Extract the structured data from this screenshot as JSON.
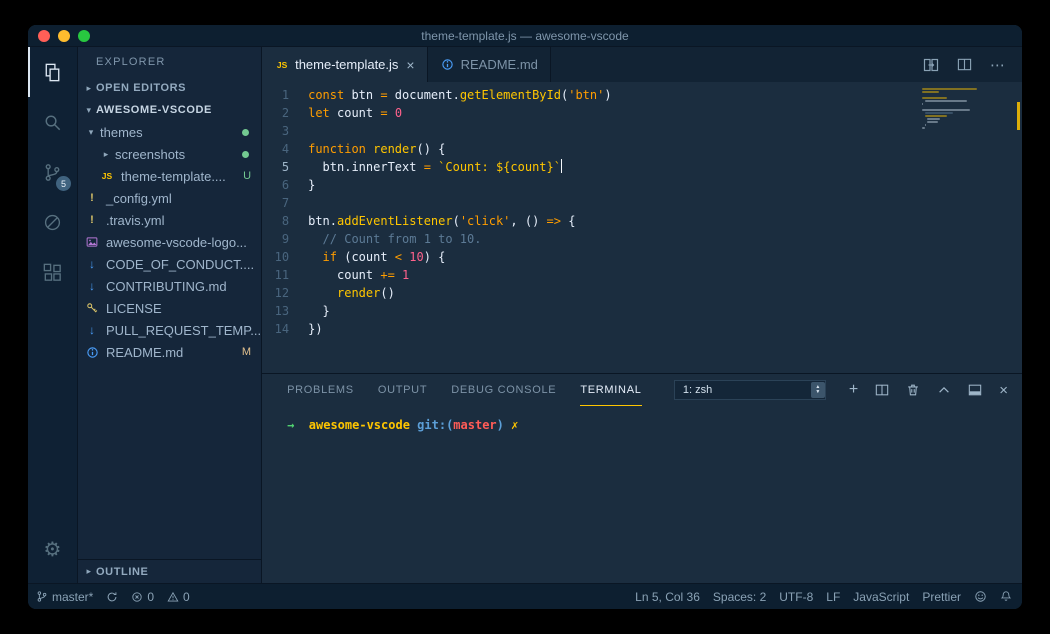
{
  "window": {
    "title": "theme-template.js — awesome-vscode"
  },
  "colors": {
    "accent_yellow": "#ffc600",
    "keyword_orange": "#ff9d00",
    "number_pink": "#ff628c",
    "comment_gray": "#5c7a95",
    "git_untracked_green": "#73c991",
    "git_modified_tan": "#e2c08d",
    "editor_bg": "#1b2d3f",
    "sidebar_bg": "#15263a",
    "statusbar_bg": "#0d1f30",
    "traffic_red": "#ff5f57",
    "traffic_yellow": "#febc2e",
    "traffic_green": "#28c840"
  },
  "icons": {
    "close": "×",
    "more": "⋯",
    "add": "+",
    "collapsed": "▸",
    "expanded": "▾",
    "stepper_up": "▲",
    "stepper_down": "▼",
    "gear": "⚙",
    "js_label": "JS",
    "yml_mark": "!",
    "md_arrow": "↓"
  },
  "activity_bar": {
    "badge": "5",
    "items": [
      {
        "name": "explorer",
        "active": true
      },
      {
        "name": "search",
        "active": false
      },
      {
        "name": "source-control",
        "active": false,
        "badge": "5"
      },
      {
        "name": "debug",
        "active": false
      },
      {
        "name": "extensions",
        "active": false
      },
      {
        "name": "settings",
        "active": false
      }
    ]
  },
  "sidebar": {
    "header": "EXPLORER",
    "open_editors_label": "OPEN EDITORS",
    "root_label": "AWESOME-VSCODE",
    "outline_label": "OUTLINE",
    "tree": [
      {
        "label": "themes",
        "indent": 1,
        "arrow": "down",
        "badge": "dot"
      },
      {
        "label": "screenshots",
        "indent": 2,
        "arrow": "right",
        "badge": "dot"
      },
      {
        "label": "theme-template....",
        "indent": 2,
        "icon": "js",
        "badge": "U"
      },
      {
        "label": "_config.yml",
        "indent": 1,
        "icon": "yaml"
      },
      {
        "label": ".travis.yml",
        "indent": 1,
        "icon": "yaml"
      },
      {
        "label": "awesome-vscode-logo...",
        "indent": 1,
        "icon": "image"
      },
      {
        "label": "CODE_OF_CONDUCT....",
        "indent": 1,
        "icon": "markdown"
      },
      {
        "label": "CONTRIBUTING.md",
        "indent": 1,
        "icon": "markdown"
      },
      {
        "label": "LICENSE",
        "indent": 1,
        "icon": "key"
      },
      {
        "label": "PULL_REQUEST_TEMP...",
        "indent": 1,
        "icon": "markdown"
      },
      {
        "label": "README.md",
        "indent": 1,
        "icon": "info",
        "badge": "M"
      }
    ]
  },
  "tabs": [
    {
      "label": "theme-template.js",
      "icon": "js",
      "active": true,
      "close": true
    },
    {
      "label": "README.md",
      "icon": "info",
      "active": false,
      "close": false
    }
  ],
  "editor": {
    "active_line": 5,
    "lines": [
      {
        "num": 1,
        "tokens": [
          [
            "kw",
            "const"
          ],
          [
            "pl",
            " btn "
          ],
          [
            "op",
            "="
          ],
          [
            "pl",
            " document."
          ],
          [
            "fn",
            "getElementById"
          ],
          [
            "pl",
            "("
          ],
          [
            "str",
            "'btn'"
          ],
          [
            "pl",
            ")"
          ]
        ]
      },
      {
        "num": 2,
        "tokens": [
          [
            "kw",
            "let"
          ],
          [
            "pl",
            " count "
          ],
          [
            "op",
            "="
          ],
          [
            "pl",
            " "
          ],
          [
            "num",
            "0"
          ]
        ]
      },
      {
        "num": 3,
        "tokens": []
      },
      {
        "num": 4,
        "tokens": [
          [
            "kw",
            "function"
          ],
          [
            "pl",
            " "
          ],
          [
            "fn",
            "render"
          ],
          [
            "pl",
            "() {"
          ]
        ]
      },
      {
        "num": 5,
        "tokens": [
          [
            "pl",
            "  btn.innerText "
          ],
          [
            "op",
            "="
          ],
          [
            "pl",
            " "
          ],
          [
            "tstr",
            "`Count: ${count}`"
          ]
        ],
        "cursor": true
      },
      {
        "num": 6,
        "tokens": [
          [
            "pl",
            "}"
          ]
        ]
      },
      {
        "num": 7,
        "tokens": []
      },
      {
        "num": 8,
        "tokens": [
          [
            "pl",
            "btn."
          ],
          [
            "fn",
            "addEventListener"
          ],
          [
            "pl",
            "("
          ],
          [
            "str",
            "'click'"
          ],
          [
            "pl",
            ", () "
          ],
          [
            "op",
            "=>"
          ],
          [
            "pl",
            " {"
          ]
        ]
      },
      {
        "num": 9,
        "tokens": [
          [
            "cm",
            "  // Count from 1 to 10."
          ]
        ]
      },
      {
        "num": 10,
        "tokens": [
          [
            "pl",
            "  "
          ],
          [
            "kw",
            "if"
          ],
          [
            "pl",
            " (count "
          ],
          [
            "op",
            "<"
          ],
          [
            "pl",
            " "
          ],
          [
            "num",
            "10"
          ],
          [
            "pl",
            ") {"
          ]
        ]
      },
      {
        "num": 11,
        "tokens": [
          [
            "pl",
            "    count "
          ],
          [
            "op",
            "+="
          ],
          [
            "pl",
            " "
          ],
          [
            "num",
            "1"
          ]
        ]
      },
      {
        "num": 12,
        "tokens": [
          [
            "pl",
            "    "
          ],
          [
            "fn",
            "render"
          ],
          [
            "pl",
            "()"
          ]
        ]
      },
      {
        "num": 13,
        "tokens": [
          [
            "pl",
            "  }"
          ]
        ]
      },
      {
        "num": 14,
        "tokens": [
          [
            "pl",
            "})"
          ]
        ]
      }
    ]
  },
  "panel": {
    "tabs": [
      {
        "label": "PROBLEMS",
        "active": false
      },
      {
        "label": "OUTPUT",
        "active": false
      },
      {
        "label": "DEBUG CONSOLE",
        "active": false
      },
      {
        "label": "TERMINAL",
        "active": true
      }
    ],
    "dropdown_value": "1: zsh",
    "terminal": {
      "segments": [
        [
          "t-arrow",
          "→"
        ],
        [
          "t-pl",
          "  "
        ],
        [
          "t-dir",
          "awesome-vscode"
        ],
        [
          "t-pl",
          " "
        ],
        [
          "t-git",
          "git:("
        ],
        [
          "t-branch",
          "master"
        ],
        [
          "t-git",
          ")"
        ],
        [
          "t-pl",
          " "
        ],
        [
          "t-x",
          "✗"
        ]
      ]
    }
  },
  "status_bar": {
    "left": [
      {
        "icon": "branch",
        "label": "master*"
      },
      {
        "icon": "sync",
        "label": ""
      },
      {
        "icon": "error",
        "label": "0"
      },
      {
        "icon": "warning",
        "label": "0"
      }
    ],
    "right": [
      {
        "label": "Ln 5, Col 36"
      },
      {
        "label": "Spaces: 2"
      },
      {
        "label": "UTF-8"
      },
      {
        "label": "LF"
      },
      {
        "label": "JavaScript"
      },
      {
        "label": "Prettier"
      },
      {
        "icon": "smiley",
        "label": ""
      },
      {
        "icon": "bell",
        "label": ""
      }
    ]
  }
}
